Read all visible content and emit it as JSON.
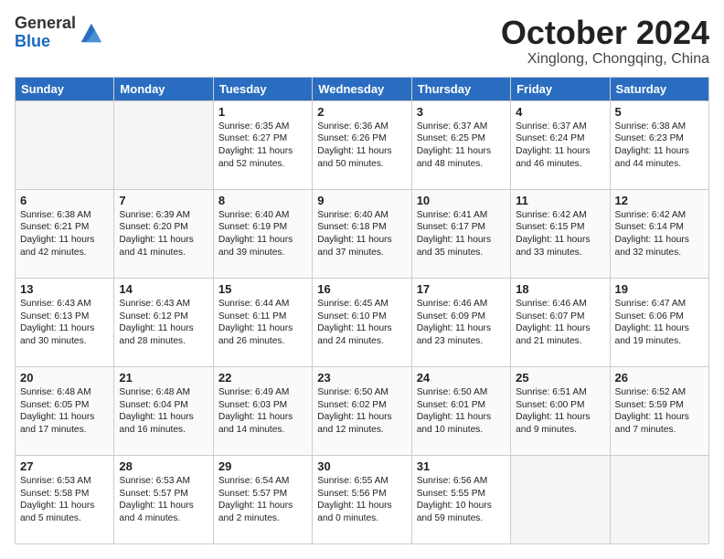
{
  "header": {
    "logo_general": "General",
    "logo_blue": "Blue",
    "month": "October 2024",
    "location": "Xinglong, Chongqing, China"
  },
  "weekdays": [
    "Sunday",
    "Monday",
    "Tuesday",
    "Wednesday",
    "Thursday",
    "Friday",
    "Saturday"
  ],
  "weeks": [
    [
      {
        "day": "",
        "empty": true
      },
      {
        "day": "",
        "empty": true
      },
      {
        "day": "1",
        "sunrise": "Sunrise: 6:35 AM",
        "sunset": "Sunset: 6:27 PM",
        "daylight": "Daylight: 11 hours and 52 minutes."
      },
      {
        "day": "2",
        "sunrise": "Sunrise: 6:36 AM",
        "sunset": "Sunset: 6:26 PM",
        "daylight": "Daylight: 11 hours and 50 minutes."
      },
      {
        "day": "3",
        "sunrise": "Sunrise: 6:37 AM",
        "sunset": "Sunset: 6:25 PM",
        "daylight": "Daylight: 11 hours and 48 minutes."
      },
      {
        "day": "4",
        "sunrise": "Sunrise: 6:37 AM",
        "sunset": "Sunset: 6:24 PM",
        "daylight": "Daylight: 11 hours and 46 minutes."
      },
      {
        "day": "5",
        "sunrise": "Sunrise: 6:38 AM",
        "sunset": "Sunset: 6:23 PM",
        "daylight": "Daylight: 11 hours and 44 minutes."
      }
    ],
    [
      {
        "day": "6",
        "sunrise": "Sunrise: 6:38 AM",
        "sunset": "Sunset: 6:21 PM",
        "daylight": "Daylight: 11 hours and 42 minutes."
      },
      {
        "day": "7",
        "sunrise": "Sunrise: 6:39 AM",
        "sunset": "Sunset: 6:20 PM",
        "daylight": "Daylight: 11 hours and 41 minutes."
      },
      {
        "day": "8",
        "sunrise": "Sunrise: 6:40 AM",
        "sunset": "Sunset: 6:19 PM",
        "daylight": "Daylight: 11 hours and 39 minutes."
      },
      {
        "day": "9",
        "sunrise": "Sunrise: 6:40 AM",
        "sunset": "Sunset: 6:18 PM",
        "daylight": "Daylight: 11 hours and 37 minutes."
      },
      {
        "day": "10",
        "sunrise": "Sunrise: 6:41 AM",
        "sunset": "Sunset: 6:17 PM",
        "daylight": "Daylight: 11 hours and 35 minutes."
      },
      {
        "day": "11",
        "sunrise": "Sunrise: 6:42 AM",
        "sunset": "Sunset: 6:15 PM",
        "daylight": "Daylight: 11 hours and 33 minutes."
      },
      {
        "day": "12",
        "sunrise": "Sunrise: 6:42 AM",
        "sunset": "Sunset: 6:14 PM",
        "daylight": "Daylight: 11 hours and 32 minutes."
      }
    ],
    [
      {
        "day": "13",
        "sunrise": "Sunrise: 6:43 AM",
        "sunset": "Sunset: 6:13 PM",
        "daylight": "Daylight: 11 hours and 30 minutes."
      },
      {
        "day": "14",
        "sunrise": "Sunrise: 6:43 AM",
        "sunset": "Sunset: 6:12 PM",
        "daylight": "Daylight: 11 hours and 28 minutes."
      },
      {
        "day": "15",
        "sunrise": "Sunrise: 6:44 AM",
        "sunset": "Sunset: 6:11 PM",
        "daylight": "Daylight: 11 hours and 26 minutes."
      },
      {
        "day": "16",
        "sunrise": "Sunrise: 6:45 AM",
        "sunset": "Sunset: 6:10 PM",
        "daylight": "Daylight: 11 hours and 24 minutes."
      },
      {
        "day": "17",
        "sunrise": "Sunrise: 6:46 AM",
        "sunset": "Sunset: 6:09 PM",
        "daylight": "Daylight: 11 hours and 23 minutes."
      },
      {
        "day": "18",
        "sunrise": "Sunrise: 6:46 AM",
        "sunset": "Sunset: 6:07 PM",
        "daylight": "Daylight: 11 hours and 21 minutes."
      },
      {
        "day": "19",
        "sunrise": "Sunrise: 6:47 AM",
        "sunset": "Sunset: 6:06 PM",
        "daylight": "Daylight: 11 hours and 19 minutes."
      }
    ],
    [
      {
        "day": "20",
        "sunrise": "Sunrise: 6:48 AM",
        "sunset": "Sunset: 6:05 PM",
        "daylight": "Daylight: 11 hours and 17 minutes."
      },
      {
        "day": "21",
        "sunrise": "Sunrise: 6:48 AM",
        "sunset": "Sunset: 6:04 PM",
        "daylight": "Daylight: 11 hours and 16 minutes."
      },
      {
        "day": "22",
        "sunrise": "Sunrise: 6:49 AM",
        "sunset": "Sunset: 6:03 PM",
        "daylight": "Daylight: 11 hours and 14 minutes."
      },
      {
        "day": "23",
        "sunrise": "Sunrise: 6:50 AM",
        "sunset": "Sunset: 6:02 PM",
        "daylight": "Daylight: 11 hours and 12 minutes."
      },
      {
        "day": "24",
        "sunrise": "Sunrise: 6:50 AM",
        "sunset": "Sunset: 6:01 PM",
        "daylight": "Daylight: 11 hours and 10 minutes."
      },
      {
        "day": "25",
        "sunrise": "Sunrise: 6:51 AM",
        "sunset": "Sunset: 6:00 PM",
        "daylight": "Daylight: 11 hours and 9 minutes."
      },
      {
        "day": "26",
        "sunrise": "Sunrise: 6:52 AM",
        "sunset": "Sunset: 5:59 PM",
        "daylight": "Daylight: 11 hours and 7 minutes."
      }
    ],
    [
      {
        "day": "27",
        "sunrise": "Sunrise: 6:53 AM",
        "sunset": "Sunset: 5:58 PM",
        "daylight": "Daylight: 11 hours and 5 minutes."
      },
      {
        "day": "28",
        "sunrise": "Sunrise: 6:53 AM",
        "sunset": "Sunset: 5:57 PM",
        "daylight": "Daylight: 11 hours and 4 minutes."
      },
      {
        "day": "29",
        "sunrise": "Sunrise: 6:54 AM",
        "sunset": "Sunset: 5:57 PM",
        "daylight": "Daylight: 11 hours and 2 minutes."
      },
      {
        "day": "30",
        "sunrise": "Sunrise: 6:55 AM",
        "sunset": "Sunset: 5:56 PM",
        "daylight": "Daylight: 11 hours and 0 minutes."
      },
      {
        "day": "31",
        "sunrise": "Sunrise: 6:56 AM",
        "sunset": "Sunset: 5:55 PM",
        "daylight": "Daylight: 10 hours and 59 minutes."
      },
      {
        "day": "",
        "empty": true
      },
      {
        "day": "",
        "empty": true
      }
    ]
  ]
}
